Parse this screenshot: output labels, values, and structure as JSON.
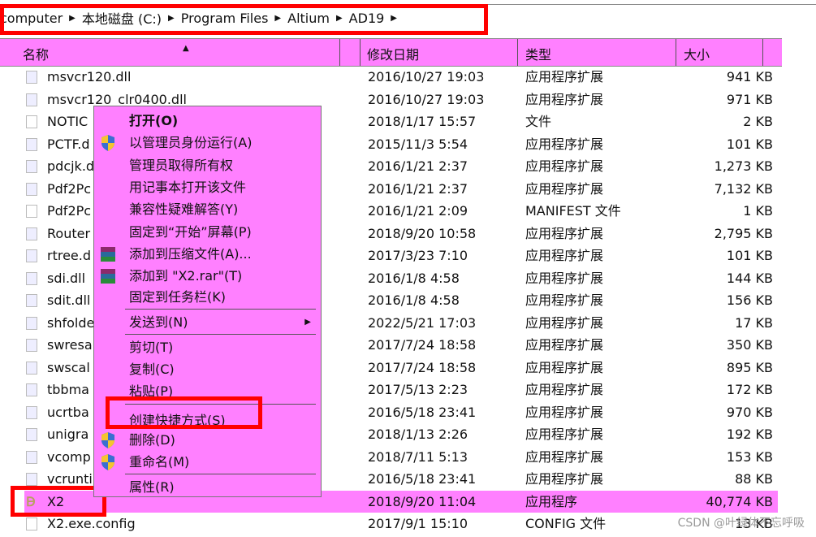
{
  "breadcrumb": [
    "computer",
    "本地磁盘 (C:)",
    "Program Files",
    "Altium",
    "AD19"
  ],
  "columns": {
    "name": "名称",
    "date": "修改日期",
    "type": "类型",
    "size": "大小"
  },
  "files": [
    {
      "name": "msvcr120.dll",
      "date": "2016/10/27 19:03",
      "type": "应用程序扩展",
      "size": "941 KB",
      "icon": "dll"
    },
    {
      "name": "msvcr120_clr0400.dll",
      "date": "2016/10/27 19:03",
      "type": "应用程序扩展",
      "size": "971 KB",
      "icon": "dll"
    },
    {
      "name": "NOTIC",
      "date": "2018/1/17 15:57",
      "type": "文件",
      "size": "2 KB",
      "icon": "file"
    },
    {
      "name": "PCTF.d",
      "date": "2015/11/3 5:54",
      "type": "应用程序扩展",
      "size": "101 KB",
      "icon": "dll"
    },
    {
      "name": "pdcjk.d",
      "date": "2016/1/21 2:37",
      "type": "应用程序扩展",
      "size": "1,273 KB",
      "icon": "dll"
    },
    {
      "name": "Pdf2Pc",
      "date": "2016/1/21 2:37",
      "type": "应用程序扩展",
      "size": "7,132 KB",
      "icon": "dll"
    },
    {
      "name": "Pdf2Pc",
      "date": "2016/1/21 2:09",
      "type": "MANIFEST 文件",
      "size": "1 KB",
      "icon": "file"
    },
    {
      "name": "Router",
      "date": "2018/9/20 10:58",
      "type": "应用程序扩展",
      "size": "2,795 KB",
      "icon": "dll"
    },
    {
      "name": "rtree.d",
      "date": "2017/3/23 7:10",
      "type": "应用程序扩展",
      "size": "101 KB",
      "icon": "dll"
    },
    {
      "name": "sdi.dll",
      "date": "2016/1/8 4:58",
      "type": "应用程序扩展",
      "size": "144 KB",
      "icon": "dll"
    },
    {
      "name": "sdit.dll",
      "date": "2016/1/8 4:58",
      "type": "应用程序扩展",
      "size": "156 KB",
      "icon": "dll"
    },
    {
      "name": "shfolde",
      "date": "2022/5/21 17:03",
      "type": "应用程序扩展",
      "size": "17 KB",
      "icon": "dll"
    },
    {
      "name": "swresa",
      "date": "2017/7/24 18:58",
      "type": "应用程序扩展",
      "size": "350 KB",
      "icon": "dll"
    },
    {
      "name": "swscal",
      "date": "2017/7/24 18:58",
      "type": "应用程序扩展",
      "size": "895 KB",
      "icon": "dll"
    },
    {
      "name": "tbbma",
      "date": "2017/5/13 2:23",
      "type": "应用程序扩展",
      "size": "172 KB",
      "icon": "dll"
    },
    {
      "name": "ucrtba",
      "date": "2016/5/18 23:41",
      "type": "应用程序扩展",
      "size": "970 KB",
      "icon": "dll"
    },
    {
      "name": "unigra",
      "date": "2018/1/13 2:26",
      "type": "应用程序扩展",
      "size": "192 KB",
      "icon": "dll"
    },
    {
      "name": "vcomp",
      "date": "2018/7/11 5:13",
      "type": "应用程序扩展",
      "size": "153 KB",
      "icon": "dll"
    },
    {
      "name": "vcrunti",
      "date": "2016/5/18 23:41",
      "type": "应用程序扩展",
      "size": "88 KB",
      "icon": "dll"
    },
    {
      "name": "X2",
      "date": "2018/9/20 11:04",
      "type": "应用程序",
      "size": "40,774 KB",
      "icon": "app",
      "selected": true
    },
    {
      "name": "X2.exe.config",
      "date": "2017/9/1 15:10",
      "type": "CONFIG 文件",
      "size": "13 KB",
      "icon": "file"
    }
  ],
  "menu": [
    {
      "label": "打开(O)",
      "bold": true
    },
    {
      "label": "以管理员身份运行(A)",
      "icon": "shield"
    },
    {
      "label": "管理员取得所有权"
    },
    {
      "label": "用记事本打开该文件"
    },
    {
      "label": "兼容性疑难解答(Y)"
    },
    {
      "label": "固定到“开始”屏幕(P)"
    },
    {
      "label": "添加到压缩文件(A)...",
      "icon": "winrar"
    },
    {
      "label": "添加到 \"X2.rar\"(T)",
      "icon": "winrar"
    },
    {
      "label": "固定到任务栏(K)"
    },
    {
      "label": "发送到(N)",
      "submenu": true
    },
    {
      "label": "剪切(T)"
    },
    {
      "label": "复制(C)"
    },
    {
      "label": "粘贴(P)"
    },
    {
      "label": "创建快捷方式(S)"
    },
    {
      "label": "删除(D)",
      "icon": "shield"
    },
    {
      "label": "重命名(M)",
      "icon": "shield"
    },
    {
      "label": "属性(R)"
    }
  ],
  "watermark": "CSDN @叶绿体不忘呼吸",
  "colors": {
    "highlight": "#ff80ff",
    "annotation": "#ff0000"
  }
}
